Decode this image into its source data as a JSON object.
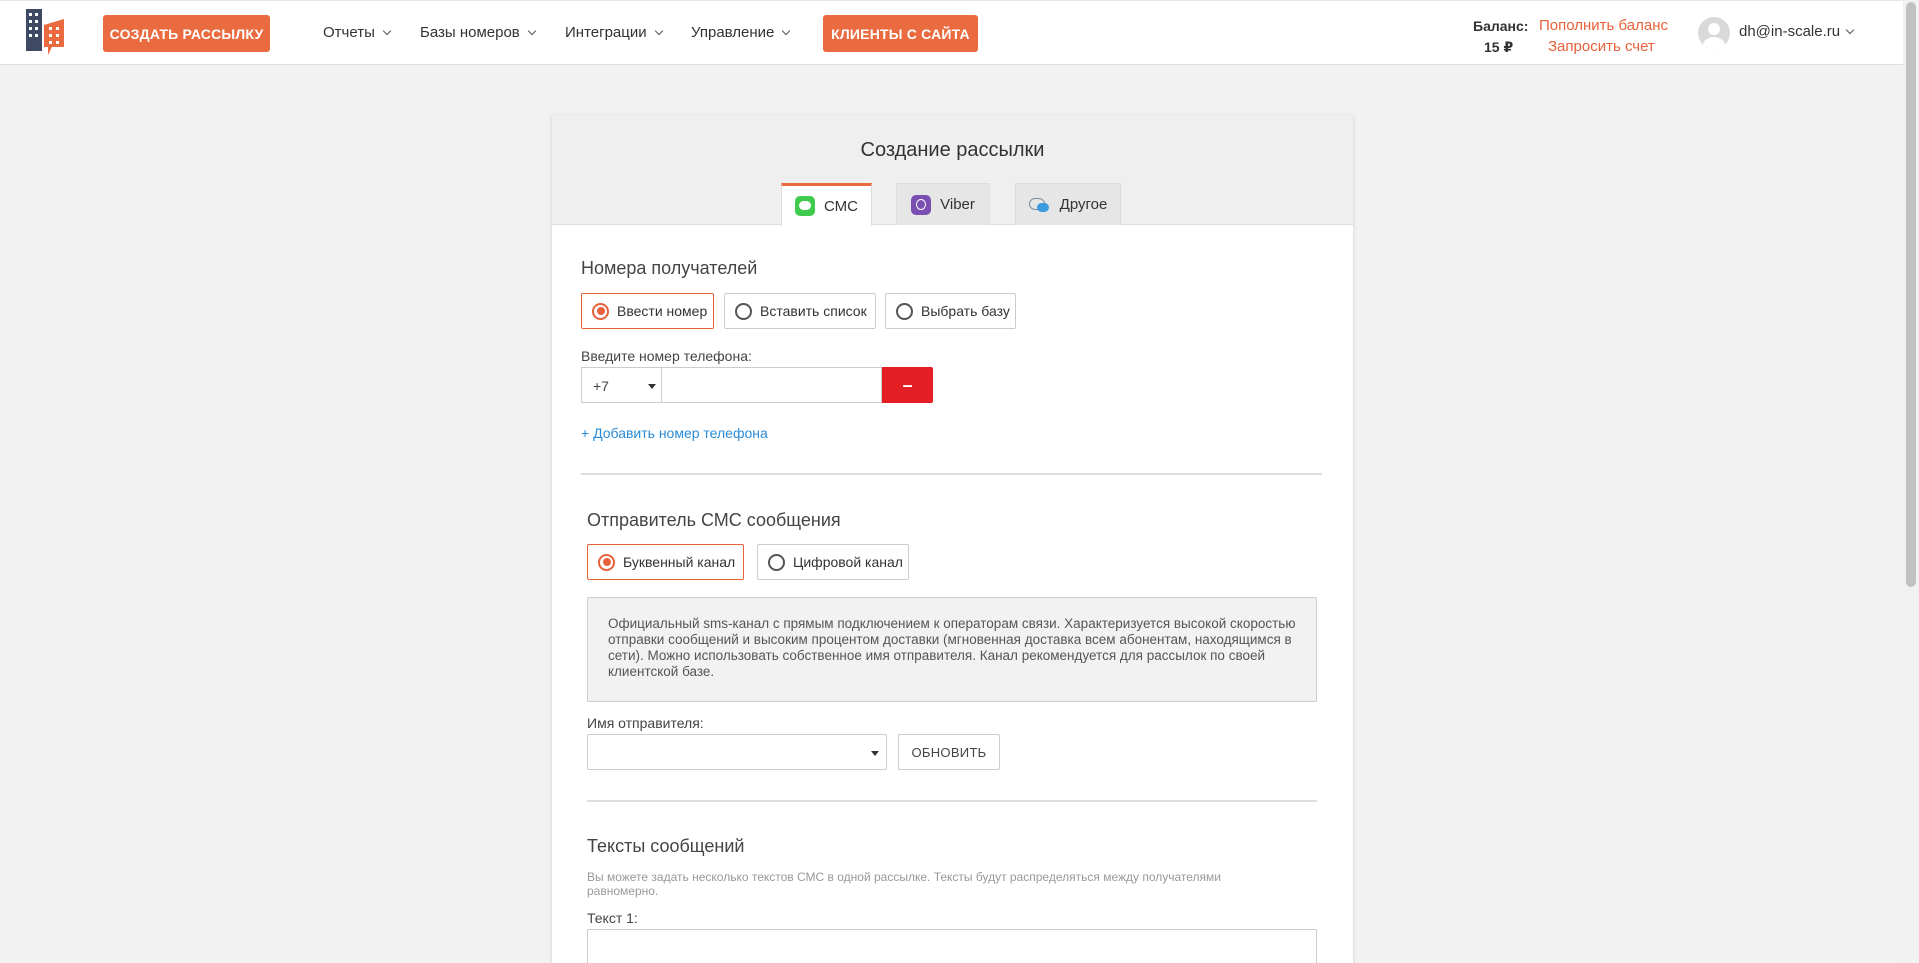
{
  "header": {
    "create_button": "СОЗДАТЬ РАССЫЛКУ",
    "nav": [
      "Отчеты",
      "Базы номеров",
      "Интеграции",
      "Управление"
    ],
    "clients_button": "КЛИЕНТЫ С САЙТА",
    "balance_label": "Баланс:",
    "balance_value": "15 ₽",
    "topup_link": "Пополнить баланс",
    "invoice_link": "Запросить счет",
    "user_email": "dh@in-scale.ru"
  },
  "card": {
    "title": "Создание рассылки",
    "tabs": [
      "СМС",
      "Viber",
      "Другое"
    ],
    "active_tab": "СМС"
  },
  "recipients": {
    "title": "Номера получателей",
    "options": [
      "Ввести номер",
      "Вставить список",
      "Выбрать базу"
    ],
    "selected": "Ввести номер",
    "phone_label": "Введите номер телефона:",
    "country_code": "+7",
    "phone_value": "",
    "remove_label": "–",
    "add_link": "+ Добавить номер телефона"
  },
  "sender": {
    "title": "Отправитель СМС сообщения",
    "options": [
      "Буквенный канал",
      "Цифровой канал"
    ],
    "selected": "Буквенный канал",
    "description": "Официальный sms-канал с прямым подключением к операторам связи. Характеризуется высокой скоростью отправки сообщений и высоким процентом доставки (мгновенная доставка всем абонентам, находящимся в сети). Можно использовать собственное имя отправителя. Канал рекомендуется для рассылок по своей клиентской базе.",
    "name_label": "Имя отправителя:",
    "name_value": "",
    "refresh_button": "ОБНОВИТЬ"
  },
  "messages": {
    "title": "Тексты сообщений",
    "hint": "Вы можете задать несколько текстов СМС в одной рассылке. Тексты будут распределяться между получателями равномерно.",
    "text1_label": "Текст 1:"
  },
  "colors": {
    "accent": "#ea6b3f",
    "danger": "#e31e24",
    "link": "#2a8bd6"
  }
}
